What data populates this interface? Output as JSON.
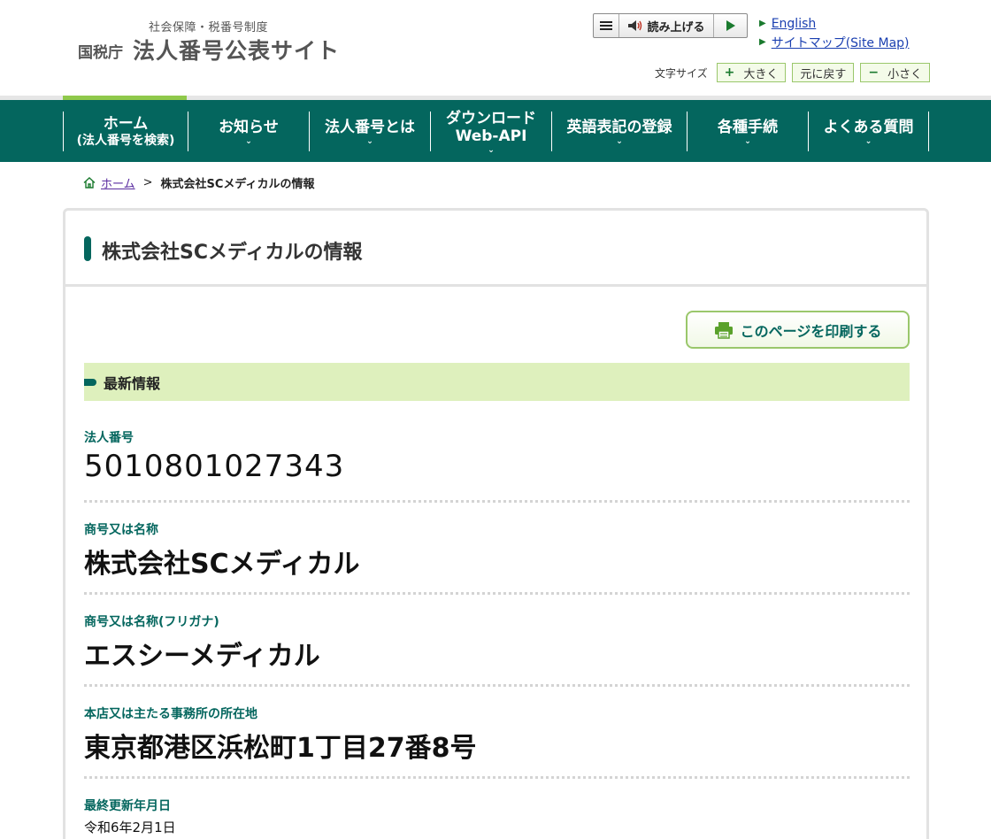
{
  "header": {
    "logo_sub": "社会保障・税番号制度",
    "logo_agency": "国税庁",
    "logo_main": "法人番号公表サイト",
    "read_aloud": "読み上げる",
    "links": [
      {
        "label": "English"
      },
      {
        "label": "サイトマップ(Site Map)"
      }
    ],
    "fontsize_label": "文字サイズ",
    "fontsize_larger": "大きく",
    "fontsize_reset": "元に戻す",
    "fontsize_smaller": "小さく"
  },
  "nav": [
    {
      "line1": "ホーム",
      "line2": "(法人番号を検索)"
    },
    {
      "line1": "お知らせ"
    },
    {
      "line1": "法人番号とは"
    },
    {
      "line1": "ダウンロード",
      "line2": "Web-API"
    },
    {
      "line1": "英語表記の登録"
    },
    {
      "line1": "各種手続"
    },
    {
      "line1": "よくある質問"
    }
  ],
  "breadcrumb": {
    "home": "ホーム",
    "separator": ">",
    "current": "株式会社SCメディカルの情報"
  },
  "panel": {
    "title": "株式会社SCメディカルの情報",
    "print_button": "このページを印刷する",
    "section_title": "最新情報",
    "fields": [
      {
        "label": "法人番号",
        "value": "5010801027343"
      },
      {
        "label": "商号又は名称",
        "value": "株式会社SCメディカル"
      },
      {
        "label": "商号又は名称(フリガナ)",
        "value": "エスシーメディカル"
      },
      {
        "label": "本店又は主たる事務所の所在地",
        "value": "東京都港区浜松町1丁目27番8号"
      },
      {
        "label": "最終更新年月日",
        "value": "令和6年2月1日"
      }
    ]
  },
  "colors": {
    "brand_green": "#04665e",
    "accent_lime": "#8fc94b",
    "section_bg": "#def0bd",
    "link_blue": "#1a3fb0"
  }
}
